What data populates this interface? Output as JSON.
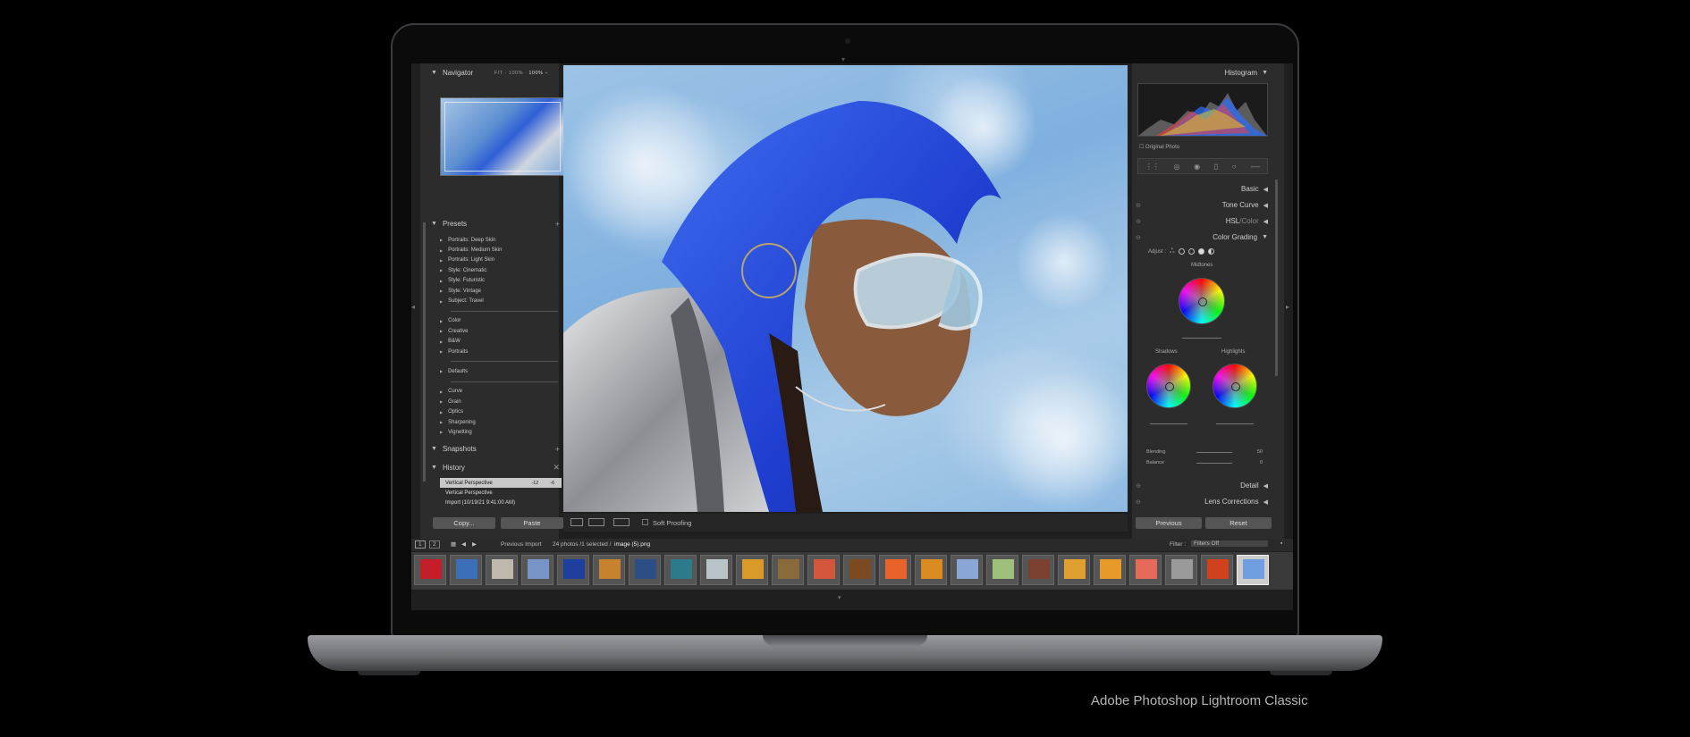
{
  "caption": "Adobe Photoshop Lightroom Classic",
  "left_panel": {
    "navigator": {
      "title": "Navigator",
      "zoom_fit": "FIT",
      "zoom_1": "100%",
      "zoom_2": "100%"
    },
    "presets": {
      "title": "Presets",
      "groups": [
        [
          "Portraits: Deep Skin",
          "Portraits: Medium Skin",
          "Portraits: Light Skin",
          "Style: Cinematic",
          "Style: Futuristic",
          "Style: Vintage",
          "Subject: Travel"
        ],
        [
          "Color",
          "Creative",
          "B&W",
          "Portraits"
        ],
        [
          "Defaults"
        ],
        [
          "Curve",
          "Grain",
          "Optics",
          "Sharpening",
          "Vignetting"
        ]
      ]
    },
    "snapshots": {
      "title": "Snapshots"
    },
    "history": {
      "title": "History",
      "items": [
        {
          "label": "Vertical Perspective",
          "v1": "-12",
          "v2": "-6"
        },
        {
          "label": "Vertical Perspective",
          "v1": "",
          "v2": ""
        },
        {
          "label": "Import (10/19/21 9:41:00 AM)",
          "v1": "",
          "v2": ""
        }
      ]
    },
    "copy_label": "Copy...",
    "paste_label": "Paste"
  },
  "toolbar": {
    "soft_proofing": "Soft Proofing"
  },
  "right_panel": {
    "histogram": {
      "title": "Histogram",
      "original_photo": "Original Photo"
    },
    "sections": {
      "basic": "Basic",
      "tone_curve": "Tone Curve",
      "hsl_prefix": "HSL",
      "hsl_sep": " / ",
      "hsl_suffix": "Color",
      "color_grading": "Color Grading",
      "detail": "Detail",
      "lens_corrections": "Lens Corrections"
    },
    "color_grading": {
      "adjust_label": "Adjust :",
      "midtones": "Midtones",
      "shadows": "Shadows",
      "highlights": "Highlights",
      "blending_label": "Blending",
      "blending_value": "50",
      "balance_label": "Balance",
      "balance_value": "0"
    },
    "previous_label": "Previous",
    "reset_label": "Reset"
  },
  "filmstrip": {
    "page_1": "1",
    "page_2": "2",
    "source": "Previous Import",
    "count_text": "24 photos /1 selected /",
    "filename": "image (5).png",
    "filter_label": "Filter :",
    "filter_value": "Filters Off",
    "thumb_colors": [
      "#c41e2a",
      "#3b6fb8",
      "#bfb9ad",
      "#7895c8",
      "#1f3f9e",
      "#c7822f",
      "#2c4d86",
      "#2d7a8a",
      "#b8c4c8",
      "#d99a28",
      "#8a6a3a",
      "#d2573a",
      "#7b4a20",
      "#e8632a",
      "#d98a20",
      "#8aa6d6",
      "#9fc07a",
      "#7a4030",
      "#e0a030",
      "#e79a2a",
      "#e66a5a",
      "#9a9a9a",
      "#d0421e",
      "#6f9fe0"
    ]
  },
  "colors": {
    "panel_bg": "#2c2c2c",
    "selected_row": "#c8c8c8",
    "accent_blue": "#2b55c9"
  }
}
